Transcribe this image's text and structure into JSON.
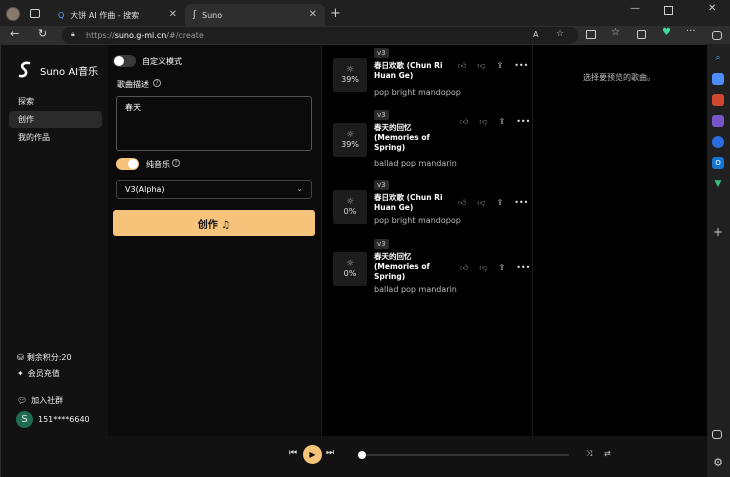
{
  "browser": {
    "tabs": [
      {
        "title": "大饼 AI 作曲 - 搜索",
        "icon": "search-icon"
      },
      {
        "title": "Suno",
        "icon": "suno-logo-icon"
      }
    ],
    "url_prefix": "https://",
    "url_main": "suno.g-mi.cn",
    "url_rest": "/#/create"
  },
  "sidebar": {
    "brand": "Suno AI音乐",
    "nav": [
      {
        "label": "探索"
      },
      {
        "label": "创作",
        "active": true
      },
      {
        "label": "我的作品"
      }
    ],
    "credits": "剩余积分:20",
    "recharge": "会员充值",
    "community": "加入社群",
    "avatar_letter": "S",
    "user": "151****6640"
  },
  "form": {
    "custom_mode_label": "自定义模式",
    "custom_mode_on": false,
    "desc_label": "歌曲描述",
    "desc_value": "春天",
    "instrumental_label": "纯音乐",
    "instrumental_on": true,
    "model_value": "V3(Alpha)",
    "create_label": "创作 ♫"
  },
  "songs": [
    {
      "version": "v3",
      "progress": "39%",
      "title_lines": [
        "春日欢歌 (Chun Ri",
        "Huan Ge)"
      ],
      "style": "pop bright mandopop"
    },
    {
      "version": "v3",
      "progress": "39%",
      "title_lines": [
        "春天的回忆",
        "(Memories of",
        "Spring)"
      ],
      "style": "ballad pop mandarin"
    },
    {
      "version": "v3",
      "progress": "0%",
      "title_lines": [
        "春日欢歌 (Chun Ri",
        "Huan Ge)"
      ],
      "style": "pop bright mandopop"
    },
    {
      "version": "v3",
      "progress": "0%",
      "title_lines": [
        "春天的回忆",
        "(Memories of",
        "Spring)"
      ],
      "style": "ballad pop mandarin"
    }
  ],
  "preview_hint": "选择要预览的歌曲。",
  "player": {
    "progress": 0
  },
  "colors": {
    "accent": "#f5c37a",
    "background": "#000000",
    "panel": "#121212"
  }
}
